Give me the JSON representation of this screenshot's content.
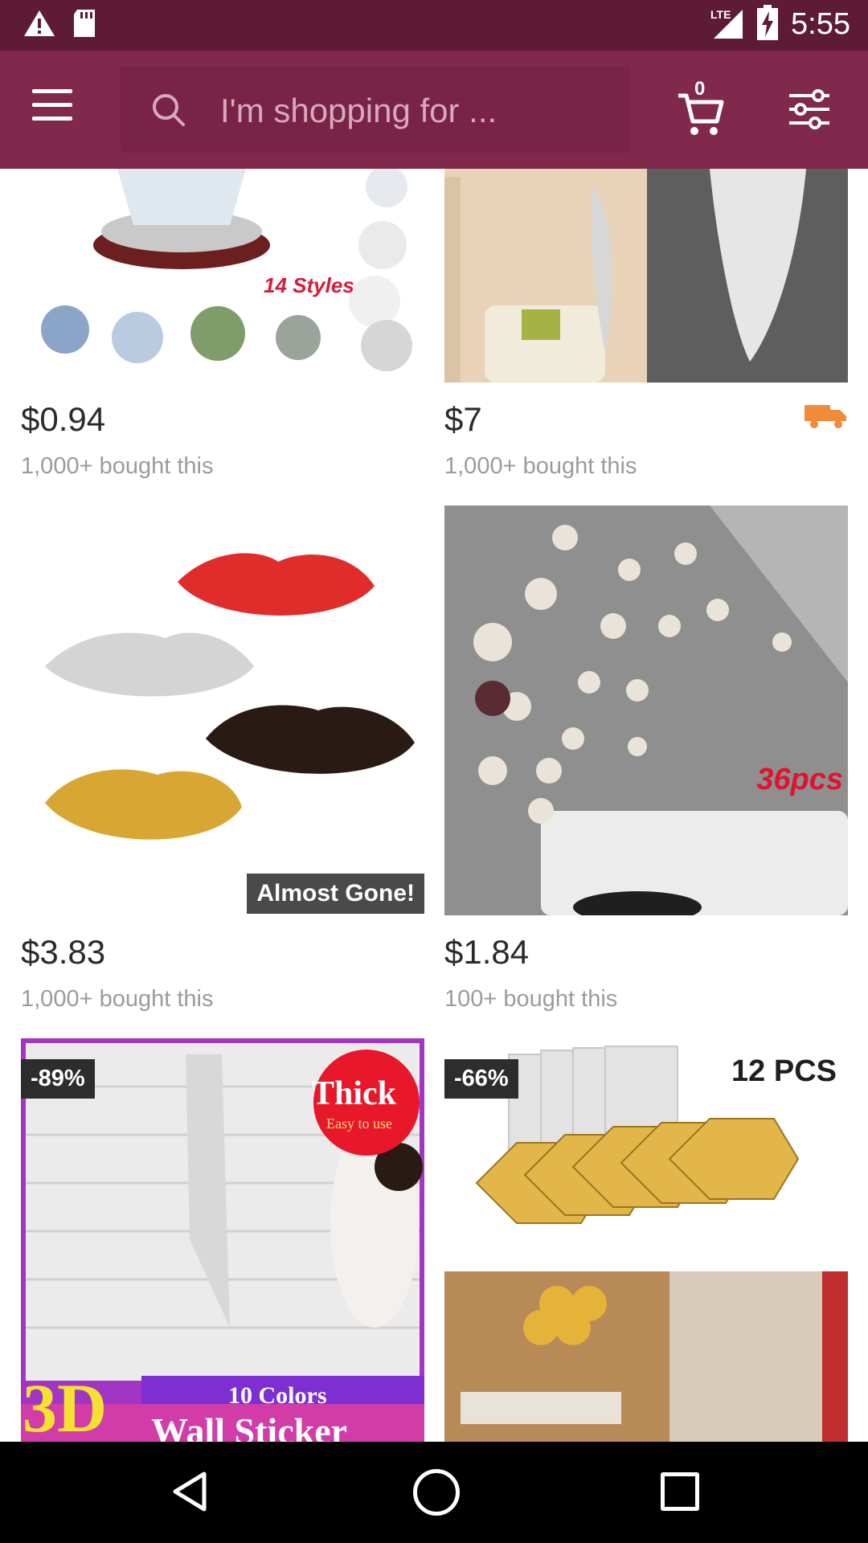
{
  "status_bar": {
    "time": "5:55",
    "network": "LTE"
  },
  "search": {
    "placeholder": "I'm shopping for ..."
  },
  "cart": {
    "count": "0"
  },
  "products": [
    {
      "price": "$0.94",
      "bought": "1,000+ bought this",
      "image_text": "14 Styles"
    },
    {
      "price": "$7",
      "bought": "1,000+ bought this",
      "shipping_icon": "truck-icon"
    },
    {
      "price": "$3.83",
      "bought": "1,000+ bought this",
      "badge": "Almost Gone!"
    },
    {
      "price": "$1.84",
      "bought": "100+ bought this",
      "image_text": "36pcs"
    },
    {
      "discount": "-89%",
      "image_text_1": "Thick",
      "image_text_2": "Easy to use",
      "image_text_3": "3D",
      "image_text_4": "10 Colors",
      "image_text_5": "Wall Sticker"
    },
    {
      "discount": "-66%",
      "image_text": "12 PCS"
    }
  ],
  "colors": {
    "status_bar": "#5e1b36",
    "app_bar": "#80294d",
    "search_field": "#792347",
    "shipping_icon": "#f08b3a"
  }
}
